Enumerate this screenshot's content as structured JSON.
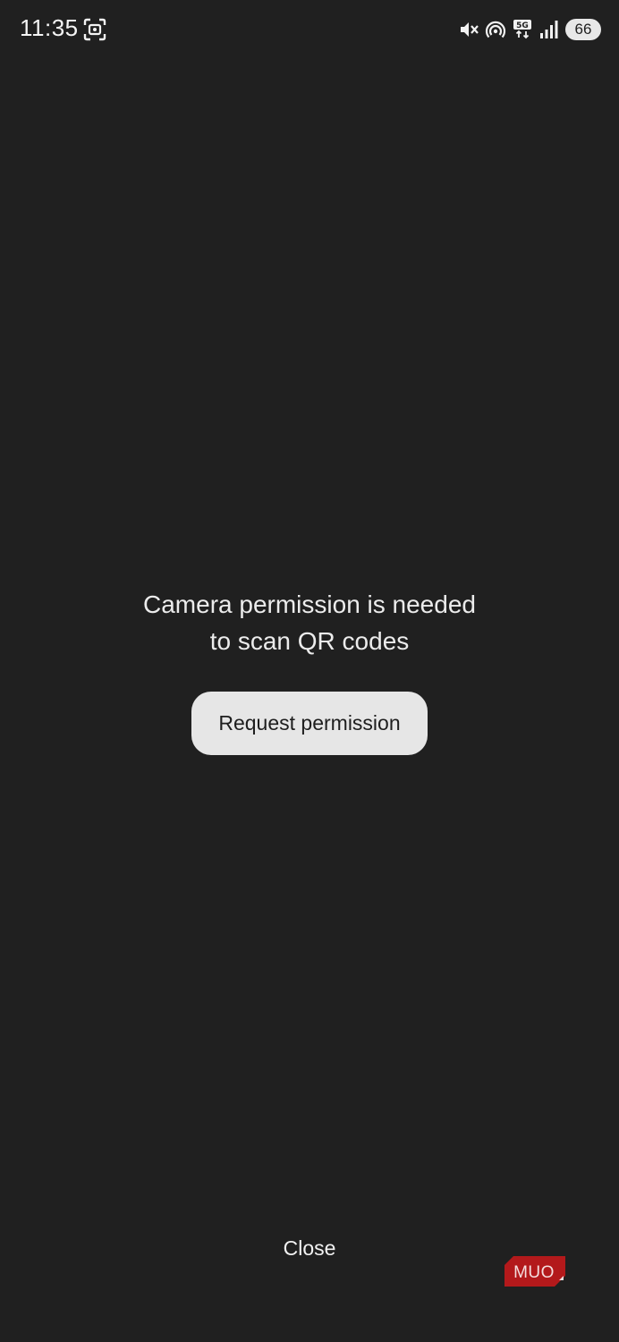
{
  "status_bar": {
    "time": "11:35",
    "battery_level": "66",
    "icons": [
      "screenshot-icon",
      "mute-icon",
      "hotspot-icon",
      "network-5g-icon",
      "signal-icon",
      "battery-icon"
    ]
  },
  "main": {
    "message_line1": "Camera permission is needed",
    "message_line2": "to scan QR codes",
    "request_button_label": "Request permission"
  },
  "footer": {
    "close_label": "Close"
  },
  "watermark": {
    "text": "MUO"
  },
  "colors": {
    "background": "#202020",
    "button_background": "#e6e6e6",
    "button_text": "#1e1e1e",
    "text": "#ececec",
    "watermark": "#b3191b"
  }
}
